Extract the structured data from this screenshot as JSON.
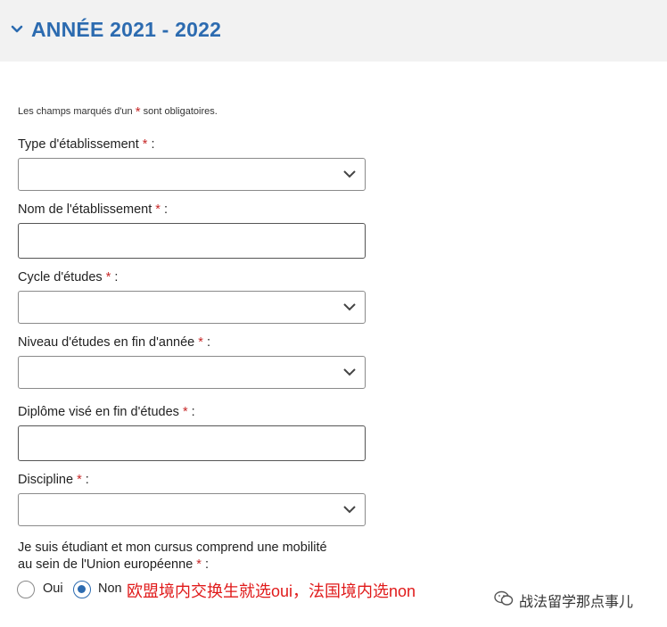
{
  "header": {
    "title": "ANNÉE 2021 - 2022",
    "chevron_icon": "chevron-down-icon",
    "accent_color": "#2c6bb0"
  },
  "required_note": {
    "prefix": "Les champs marqués d'un",
    "star": "*",
    "suffix": "sont obligatoires."
  },
  "required_color": "#c62828",
  "fields": [
    {
      "label": "Type d'établissement",
      "required_marker": "*",
      "colon": ":",
      "kind": "select",
      "value": ""
    },
    {
      "label": "Nom de l'établissement",
      "required_marker": "*",
      "colon": ":",
      "kind": "text",
      "value": ""
    },
    {
      "label": "Cycle d'études",
      "required_marker": "*",
      "colon": ":",
      "kind": "select",
      "value": ""
    },
    {
      "label": "Niveau d'études en fin d'année",
      "required_marker": "*",
      "colon": ":",
      "kind": "select",
      "value": ""
    },
    {
      "label": "Diplôme visé en fin d'études",
      "required_marker": "*",
      "colon": ":",
      "kind": "text",
      "value": ""
    },
    {
      "label": "Discipline",
      "required_marker": "*",
      "colon": ":",
      "kind": "select",
      "value": ""
    }
  ],
  "mobility": {
    "question_line1": "Je suis étudiant et mon cursus comprend une mobilité",
    "question_line2": "au sein de l'Union européenne",
    "required_marker": "*",
    "colon": ":",
    "options": [
      {
        "label": "Oui",
        "selected": false
      },
      {
        "label": "Non",
        "selected": true
      }
    ]
  },
  "annotation": "欧盟境内交换生就选oui，法国境内选non",
  "annotation_color": "#e01a1a",
  "watermark": {
    "icon": "wechat-icon",
    "text": "战法留学那点事儿"
  }
}
